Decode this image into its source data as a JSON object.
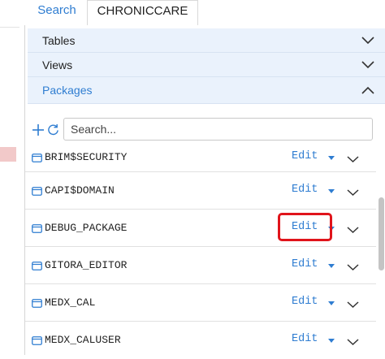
{
  "tabs": {
    "search_label": "Search",
    "active_label": "CHRONICCARE"
  },
  "sections": {
    "tables": {
      "label": "Tables",
      "expanded": false
    },
    "views": {
      "label": "Views",
      "expanded": false
    },
    "packages": {
      "label": "Packages",
      "expanded": true
    }
  },
  "toolbar": {
    "add_icon": "plus-icon",
    "refresh_icon": "refresh-icon",
    "search_placeholder": "Search...",
    "search_value": ""
  },
  "packages": [
    {
      "name": "BRIM$SECURITY",
      "edit_label": "Edit"
    },
    {
      "name": "CAPI$DOMAIN",
      "edit_label": "Edit"
    },
    {
      "name": "DEBUG_PACKAGE",
      "edit_label": "Edit",
      "highlighted": true
    },
    {
      "name": "GITORA_EDITOR",
      "edit_label": "Edit"
    },
    {
      "name": "MEDX_CAL",
      "edit_label": "Edit"
    },
    {
      "name": "MEDX_CALUSER",
      "edit_label": "Edit"
    }
  ],
  "colors": {
    "accent": "#2f7dd1",
    "section_bg": "#eaf2fc",
    "highlight": "#e0141b"
  }
}
